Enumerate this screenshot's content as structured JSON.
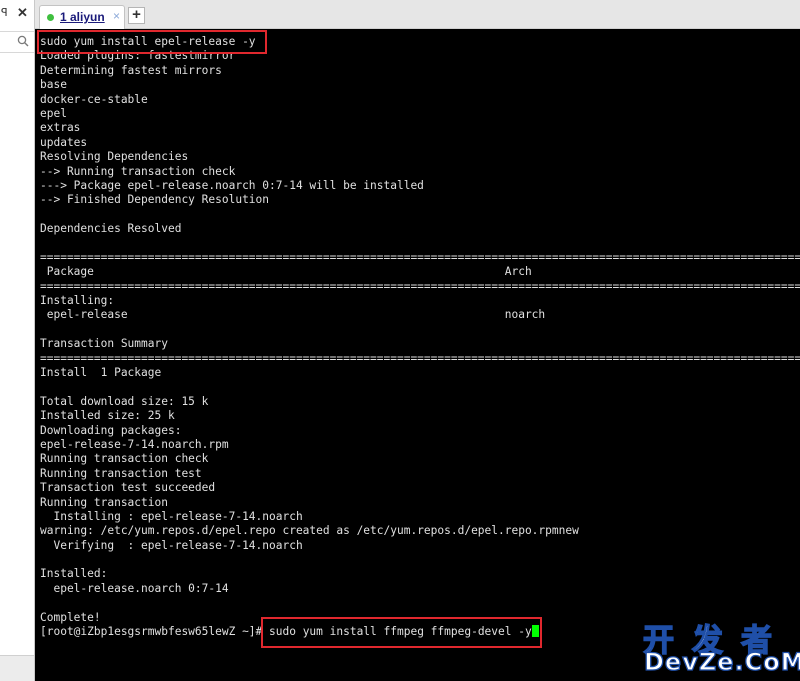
{
  "left_panel": {
    "pin_glyph": "ꟼ",
    "close_glyph": "✕"
  },
  "tabs": [
    {
      "label": "1 aliyun",
      "close_glyph": "×",
      "status_color": "#3fbf3f"
    }
  ],
  "new_tab_glyph": "+",
  "terminal": {
    "lines": [
      "sudo yum install epel-release -y",
      "Loaded plugins: fastestmirror",
      "Determining fastest mirrors",
      "base",
      "docker-ce-stable",
      "epel",
      "extras",
      "updates",
      "Resolving Dependencies",
      "--> Running transaction check",
      "---> Package epel-release.noarch 0:7-14 will be installed",
      "--> Finished Dependency Resolution",
      "",
      "Dependencies Resolved",
      "",
      "==============================================================================================================================",
      " Package                                                             Arch",
      "==============================================================================================================================",
      "Installing:",
      " epel-release                                                        noarch",
      "",
      "Transaction Summary",
      "==============================================================================================================================",
      "Install  1 Package",
      "",
      "Total download size: 15 k",
      "Installed size: 25 k",
      "Downloading packages:",
      "epel-release-7-14.noarch.rpm",
      "Running transaction check",
      "Running transaction test",
      "Transaction test succeeded",
      "Running transaction",
      "  Installing : epel-release-7-14.noarch",
      "warning: /etc/yum.repos.d/epel.repo created as /etc/yum.repos.d/epel.repo.rpmnew",
      "  Verifying  : epel-release-7-14.noarch",
      "",
      "Installed:",
      "  epel-release.noarch 0:7-14",
      "",
      "Complete!"
    ],
    "prompt": "[root@iZbp1esgsrmwbfesw65lewZ ~]# ",
    "command": "sudo yum install ffmpeg ffmpeg-devel -y",
    "cursor_color": "#00ff00",
    "highlight_color": "#e0282e"
  },
  "watermark": {
    "cn": "开发者",
    "en": "DevZe.CoM"
  }
}
